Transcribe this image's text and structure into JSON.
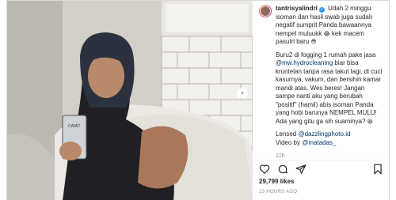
{
  "post": {
    "username": "tantrisyalindri",
    "caption_1a": "Udah 2 minggu isoman dan hasil swab juga sudah negatif sumprit Panda bawaannya nempel muluukk",
    "emoji_laugh": "😂",
    "caption_1b": "kek macem pasutri baru",
    "emoji_shy": "😳",
    "caption_2a": "Buru2 di fogging 1 rumah pake jasa",
    "mention_cleaning": "@mw.hydrocleaning",
    "caption_2b": "biar bisa kruntelan tanpa rasa takut lagi, di cuci kasurnya, vakum, dan bersihin kamar mandi atas. Wes beres! Jangan sampe nanti aku yang berubah \"positif\" (hamil) abis isoman Panda yang hobi barunya NEMPEL MULU! Ada yang gitu ga sih suaminya?",
    "emoji_ask": "😆",
    "lensed_label": "Lensed",
    "mention_photo": "@dazzlingphoto.id",
    "video_label": "Video by",
    "mention_video": "@matadas_",
    "time_relative": "22h",
    "likes": "29,799 likes",
    "posted": "23 HOURS AGO"
  },
  "icons": [
    "verified-icon",
    "heart-icon",
    "comment-icon",
    "share-icon",
    "bookmark-icon",
    "next-arrow-icon"
  ],
  "colors": {
    "link": "#003569",
    "verified": "#3897f0",
    "meta": "#8e8e8e"
  }
}
